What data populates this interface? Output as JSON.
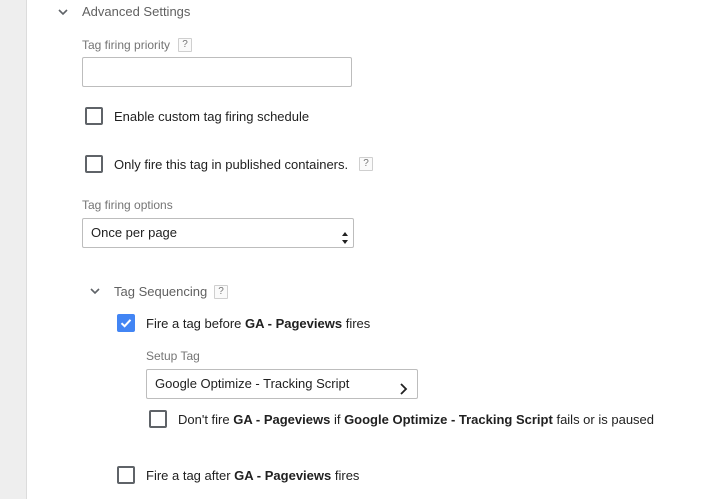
{
  "advanced": {
    "title": "Advanced Settings",
    "priority": {
      "label": "Tag firing priority",
      "help": "?",
      "value": ""
    },
    "custom_schedule": {
      "label": "Enable custom tag firing schedule",
      "checked": false
    },
    "published_only": {
      "label": "Only fire this tag in published containers.",
      "help": "?",
      "checked": false
    },
    "firing_options": {
      "label": "Tag firing options",
      "selected": "Once per page"
    }
  },
  "sequencing": {
    "title": "Tag Sequencing",
    "help": "?",
    "before": {
      "prefix": "Fire a tag before",
      "tag_name": "GA - Pageviews",
      "suffix": "fires",
      "checked": true
    },
    "setup": {
      "label": "Setup Tag",
      "selected": "Google Optimize - Tracking Script",
      "dont_fire": {
        "part1": "Don't fire",
        "tag_name": "GA - Pageviews",
        "part2": "if",
        "setup_name": "Google Optimize - Tracking Script",
        "part3": "fails or is paused",
        "checked": false
      }
    },
    "after": {
      "prefix": "Fire a tag after",
      "tag_name": "GA - Pageviews",
      "suffix": "fires",
      "checked": false
    }
  },
  "colors": {
    "accent": "#4285f4",
    "rail": "#eeeeee"
  },
  "icons": {
    "expand": "chevron-down-icon",
    "picker": "chevron-right-icon",
    "select": "up-down-arrows-icon"
  }
}
